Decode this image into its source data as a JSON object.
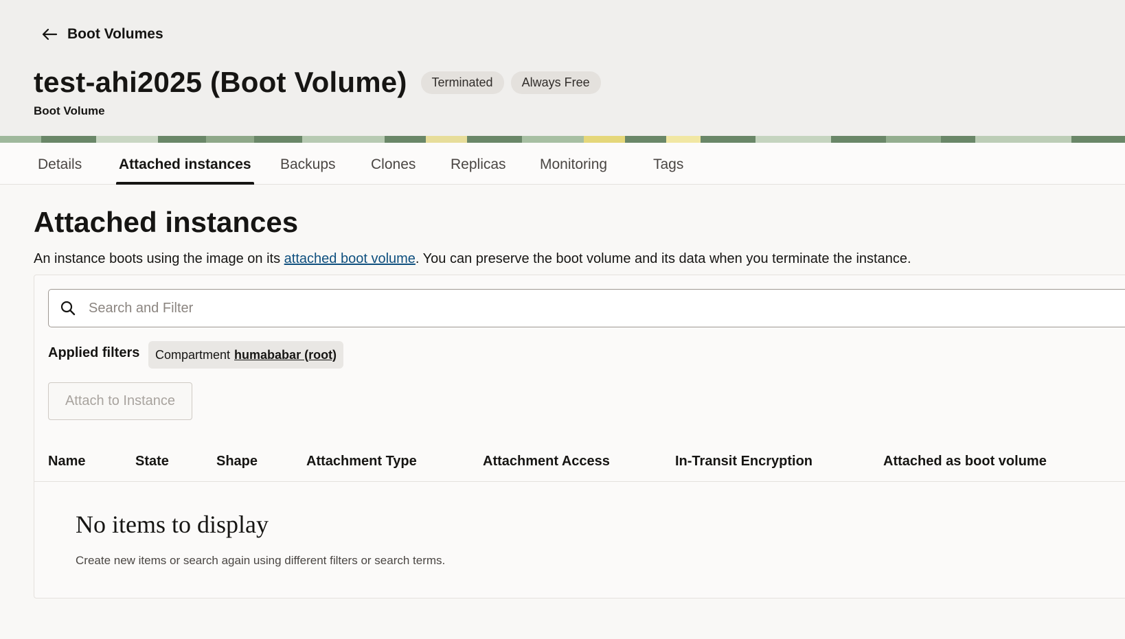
{
  "header": {
    "back_label": "Boot Volumes",
    "title": "test-ahi2025 (Boot Volume)",
    "badges": [
      "Terminated",
      "Always Free"
    ],
    "subtitle": "Boot Volume"
  },
  "tabs": [
    {
      "label": "Details",
      "active": false
    },
    {
      "label": "Attached instances",
      "active": true
    },
    {
      "label": "Backups",
      "active": false
    },
    {
      "label": "Clones",
      "active": false
    },
    {
      "label": "Replicas",
      "active": false
    },
    {
      "label": "Monitoring",
      "active": false
    },
    {
      "label": "Tags",
      "active": false
    }
  ],
  "section": {
    "title": "Attached instances",
    "desc_before": "An instance boots using the image on its ",
    "desc_link": "attached boot volume",
    "desc_after": ". You can preserve the boot volume and its data when you terminate the instance."
  },
  "search": {
    "placeholder": "Search and Filter",
    "value": ""
  },
  "filters": {
    "label": "Applied filters",
    "chip_prefix": "Compartment",
    "chip_value": "humababar (root)"
  },
  "actions": {
    "attach_label": "Attach to Instance"
  },
  "table": {
    "columns": [
      "Name",
      "State",
      "Shape",
      "Attachment Type",
      "Attachment Access",
      "In-Transit Encryption",
      "Attached as boot volume"
    ],
    "rows": []
  },
  "empty": {
    "title": "No items to display",
    "desc": "Create new items or search again using different filters or search terms."
  },
  "colors": {
    "header_bg": "#f0efed",
    "page_bg": "#f9f8f6",
    "link": "#0e4f7e",
    "text": "#161513"
  },
  "icons": {
    "back": "arrow-left-icon",
    "search": "search-icon"
  }
}
